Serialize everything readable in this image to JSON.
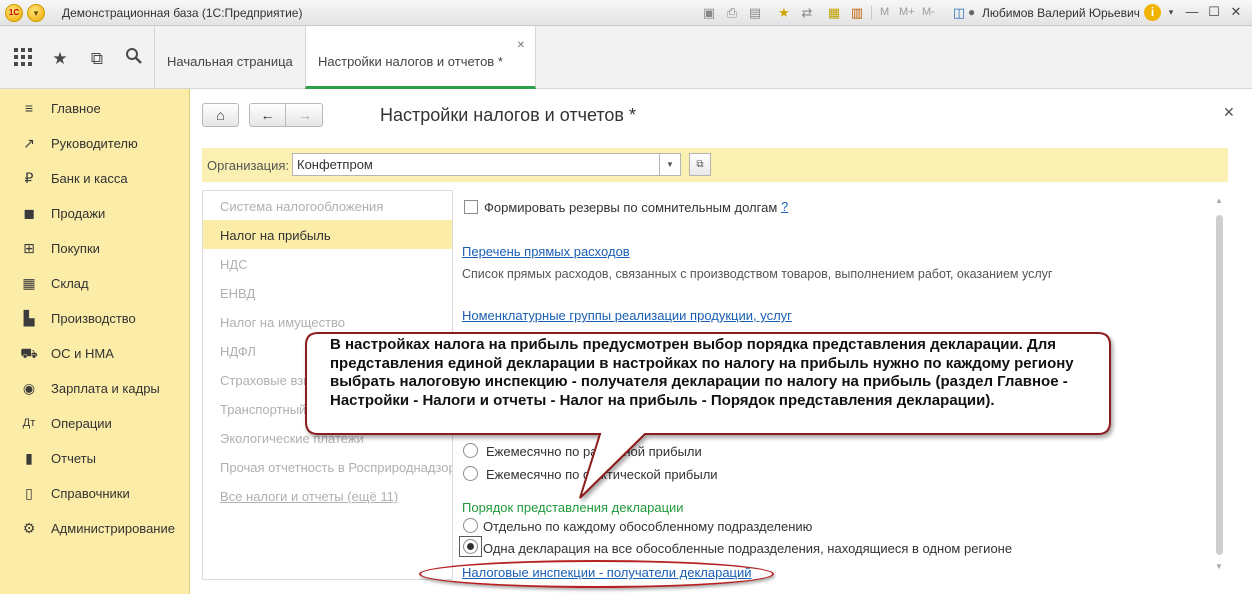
{
  "window": {
    "title": "Демонстрационная база  (1С:Предприятие)",
    "user": "Любимов Валерий Юрьевич",
    "mem_buttons": [
      "M",
      "M+",
      "M-"
    ]
  },
  "tabs": [
    {
      "label": "Начальная страница",
      "active": false
    },
    {
      "label": "Настройки налогов и отчетов *",
      "active": true
    }
  ],
  "sidebar": {
    "items": [
      {
        "label": "Главное",
        "icon": "menu-icon"
      },
      {
        "label": "Руководителю",
        "icon": "trend-icon"
      },
      {
        "label": "Банк и касса",
        "icon": "ruble-icon"
      },
      {
        "label": "Продажи",
        "icon": "bag-icon"
      },
      {
        "label": "Покупки",
        "icon": "cart-icon"
      },
      {
        "label": "Склад",
        "icon": "warehouse-icon"
      },
      {
        "label": "Производство",
        "icon": "factory-icon"
      },
      {
        "label": "ОС и НМА",
        "icon": "truck-icon"
      },
      {
        "label": "Зарплата и кадры",
        "icon": "people-icon"
      },
      {
        "label": "Операции",
        "icon": "operations-icon"
      },
      {
        "label": "Отчеты",
        "icon": "chart-icon"
      },
      {
        "label": "Справочники",
        "icon": "book-icon"
      },
      {
        "label": "Администрирование",
        "icon": "gear-icon"
      }
    ]
  },
  "form": {
    "title": "Настройки налогов и отчетов *",
    "org_label": "Организация:",
    "org_value": "Конфетпром"
  },
  "sections": [
    {
      "label": "Система налогообложения",
      "active": false
    },
    {
      "label": "Налог на прибыль",
      "active": true
    },
    {
      "label": "НДС",
      "active": false
    },
    {
      "label": "ЕНВД",
      "active": false
    },
    {
      "label": "Налог на имущество",
      "active": false
    },
    {
      "label": "НДФЛ",
      "active": false
    },
    {
      "label": "Страховые взносы",
      "active": false
    },
    {
      "label": "Транспортный налог",
      "active": false
    },
    {
      "label": "Экологические платежи",
      "active": false
    },
    {
      "label": "Прочая отчетность в Росприроднадзор",
      "active": false
    },
    {
      "label": "Все налоги и отчеты (ещё 11)",
      "active": false,
      "link": true
    }
  ],
  "content": {
    "reserve_checkbox": "Формировать резервы по сомнительным долгам",
    "help": "?",
    "direct_costs_link": "Перечень прямых расходов",
    "direct_costs_desc": "Список прямых расходов, связанных с производством товаров, выполнением работ, оказанием услуг",
    "nomenclature_link": "Номенклатурные группы реализации продукции, услуг",
    "payment_options": [
      "Ежемесячно по расчетной прибыли",
      "Ежемесячно по фактической прибыли"
    ],
    "declaration_group_title": "Порядок представления декларации",
    "declaration_options": [
      {
        "label": "Отдельно по каждому обособленному подразделению",
        "selected": false
      },
      {
        "label": "Одна декларация на все обособленные подразделения, находящиеся в одном регионе",
        "selected": true
      }
    ],
    "inspections_link": "Налоговые инспекции - получатели деклараций"
  },
  "callout": {
    "text": "В настройках налога на прибыль предусмотрен выбор порядка представления декларации. Для представления единой декларации в настройках по налогу на прибыль нужно по каждому региону выбрать налоговую инспекцию - получателя декларации по налогу на прибыль (раздел Главное - Настройки - Налоги и отчеты - Налог на прибыль - Порядок представления декларации).",
    "border_color": "#8b1a1a"
  }
}
